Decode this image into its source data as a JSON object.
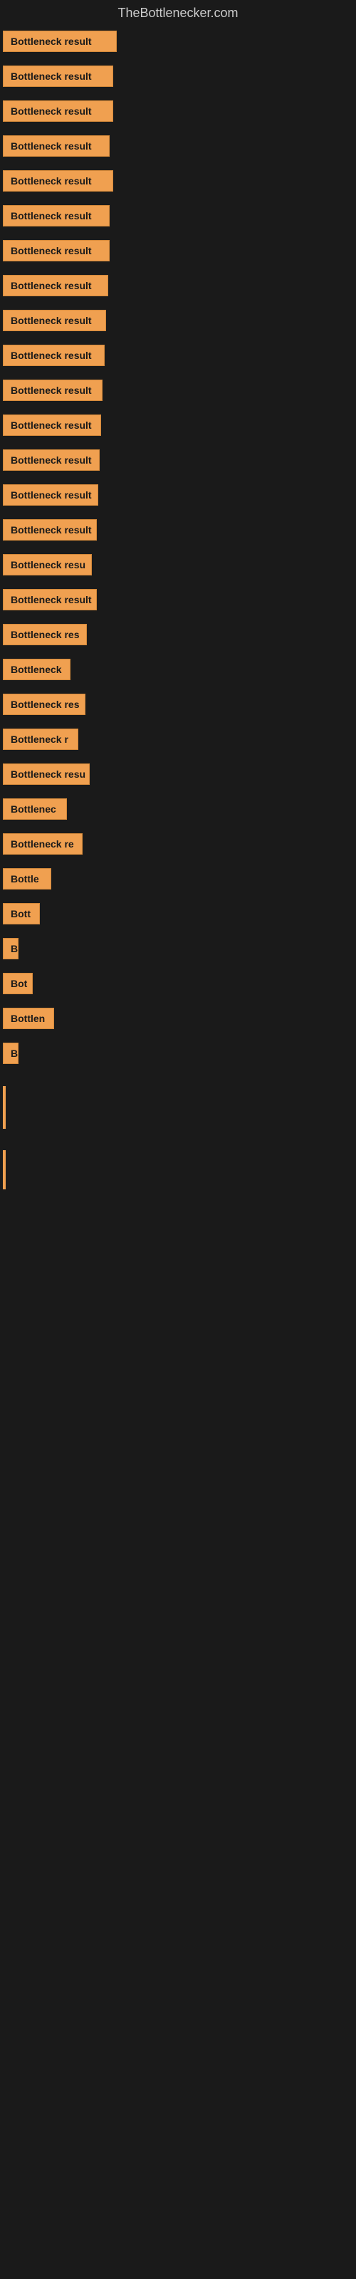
{
  "site": {
    "title": "TheBottlenecker.com"
  },
  "items": [
    {
      "label": "Bottleneck result",
      "width": 160
    },
    {
      "label": "Bottleneck result",
      "width": 155
    },
    {
      "label": "Bottleneck result",
      "width": 155
    },
    {
      "label": "Bottleneck result",
      "width": 150
    },
    {
      "label": "Bottleneck result",
      "width": 155
    },
    {
      "label": "Bottleneck result",
      "width": 150
    },
    {
      "label": "Bottleneck result",
      "width": 150
    },
    {
      "label": "Bottleneck result",
      "width": 148
    },
    {
      "label": "Bottleneck result",
      "width": 145
    },
    {
      "label": "Bottleneck result",
      "width": 143
    },
    {
      "label": "Bottleneck result",
      "width": 140
    },
    {
      "label": "Bottleneck result",
      "width": 138
    },
    {
      "label": "Bottleneck result",
      "width": 136
    },
    {
      "label": "Bottleneck result",
      "width": 134
    },
    {
      "label": "Bottleneck result",
      "width": 132
    },
    {
      "label": "Bottleneck resu",
      "width": 125
    },
    {
      "label": "Bottleneck result",
      "width": 132
    },
    {
      "label": "Bottleneck res",
      "width": 118
    },
    {
      "label": "Bottleneck",
      "width": 95
    },
    {
      "label": "Bottleneck res",
      "width": 116
    },
    {
      "label": "Bottleneck r",
      "width": 106
    },
    {
      "label": "Bottleneck resu",
      "width": 122
    },
    {
      "label": "Bottlenec",
      "width": 90
    },
    {
      "label": "Bottleneck re",
      "width": 112
    },
    {
      "label": "Bottle",
      "width": 68
    },
    {
      "label": "Bott",
      "width": 52
    },
    {
      "label": "B",
      "width": 22
    },
    {
      "label": "Bot",
      "width": 42
    },
    {
      "label": "Bottlen",
      "width": 72
    },
    {
      "label": "B",
      "width": 20
    }
  ],
  "bar_items": [
    {
      "height": 60
    },
    {
      "height": 55
    }
  ]
}
